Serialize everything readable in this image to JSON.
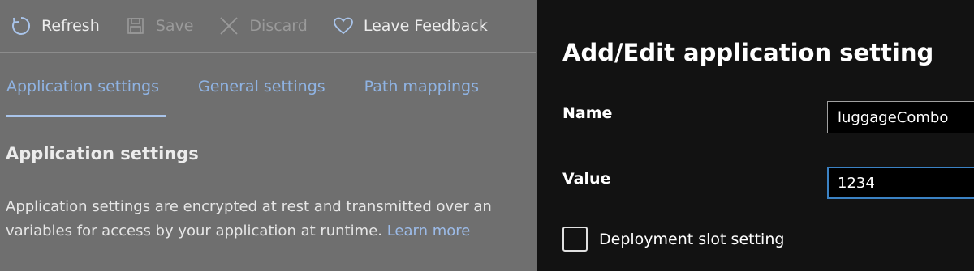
{
  "toolbar": {
    "refresh_label": "Refresh",
    "save_label": "Save",
    "discard_label": "Discard",
    "feedback_label": "Leave Feedback"
  },
  "tabs": [
    {
      "label": "Application settings",
      "active": true
    },
    {
      "label": "General settings",
      "active": false
    },
    {
      "label": "Path mappings",
      "active": false
    }
  ],
  "main": {
    "section_title": "Application settings",
    "description_line1": "Application settings are encrypted at rest and transmitted over an",
    "description_line2": "variables for access by your application at runtime.",
    "learn_more": "Learn more"
  },
  "panel": {
    "title": "Add/Edit application setting",
    "name_label": "Name",
    "name_value": "luggageCombo",
    "value_label": "Value",
    "value_value": "1234",
    "slot_setting_label": "Deployment slot setting",
    "slot_setting_checked": false
  },
  "colors": {
    "accent": "#3b82c4",
    "link": "#9cbbe8",
    "panel_bg": "#121212"
  }
}
